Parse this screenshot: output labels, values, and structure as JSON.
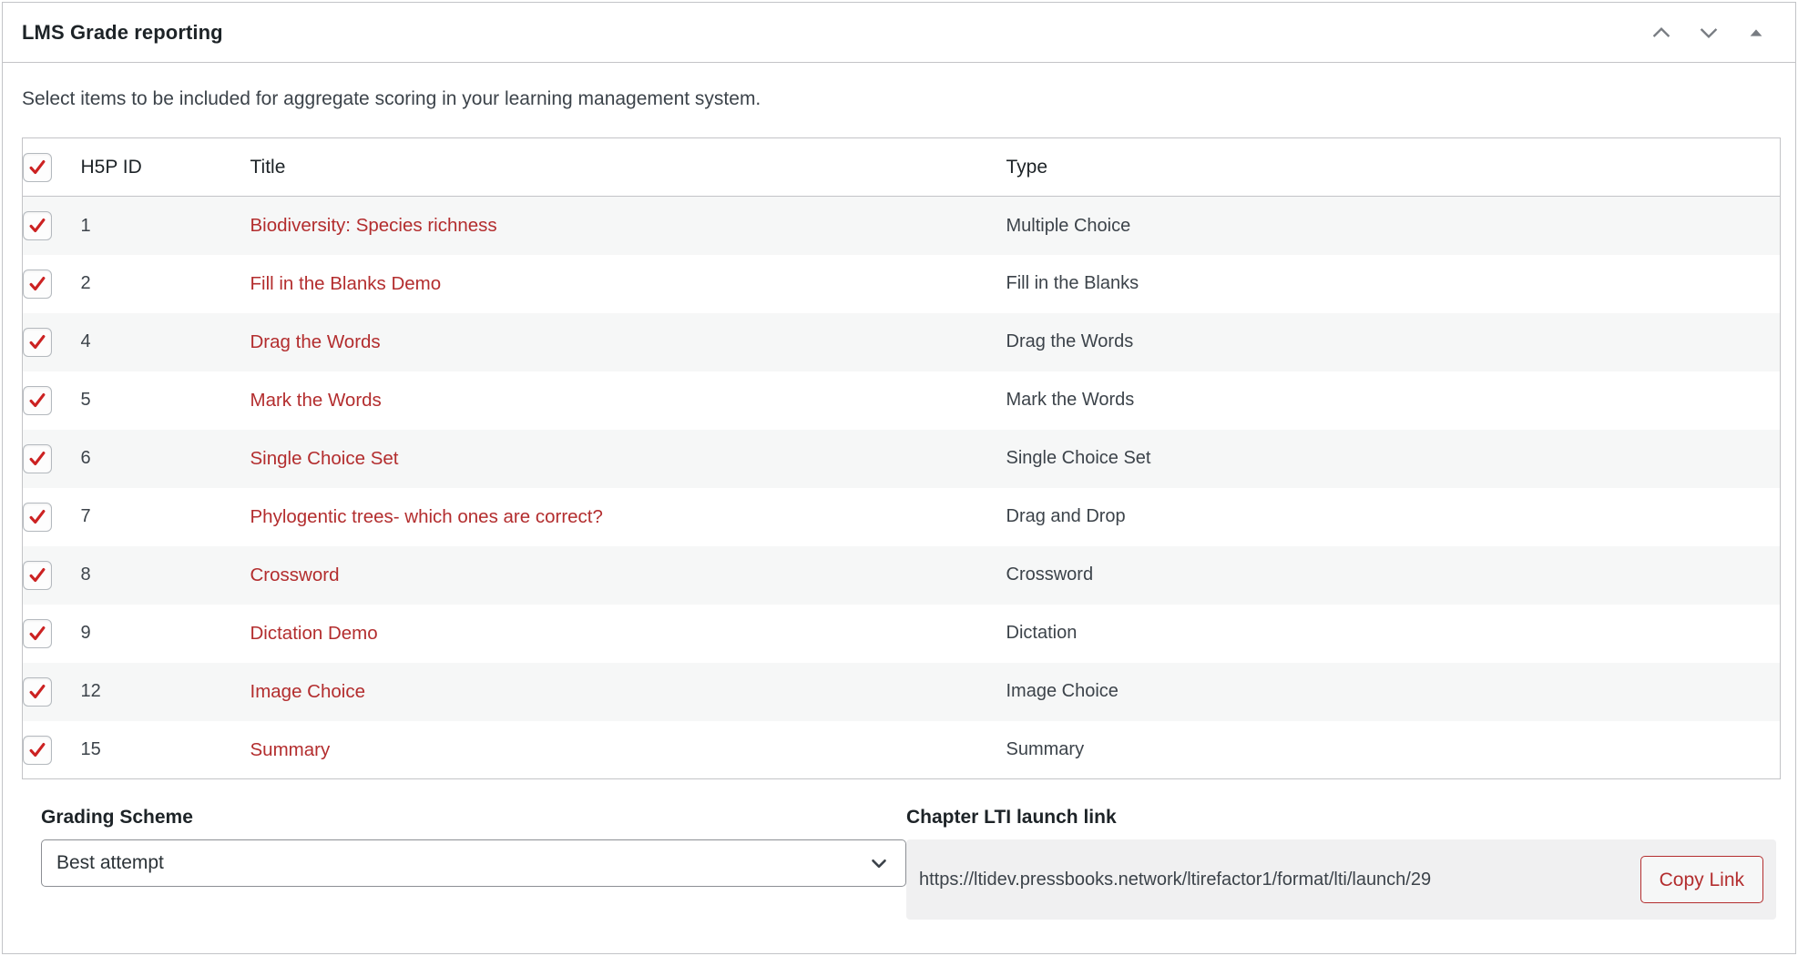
{
  "panel": {
    "title": "LMS Grade reporting",
    "intro": "Select items to be included for aggregate scoring in your learning management system.",
    "header_icons": [
      {
        "name": "chevron-up-icon",
        "label": "Move up"
      },
      {
        "name": "chevron-down-icon",
        "label": "Move down"
      },
      {
        "name": "collapse-triangle-icon",
        "label": "Toggle panel"
      }
    ]
  },
  "table": {
    "select_all_checked": true,
    "columns": {
      "checkbox": "",
      "id": "H5P ID",
      "title": "Title",
      "type": "Type"
    },
    "rows": [
      {
        "checked": true,
        "id": "1",
        "title": "Biodiversity: Species richness",
        "type": "Multiple Choice"
      },
      {
        "checked": true,
        "id": "2",
        "title": "Fill in the Blanks Demo",
        "type": "Fill in the Blanks"
      },
      {
        "checked": true,
        "id": "4",
        "title": "Drag the Words",
        "type": "Drag the Words"
      },
      {
        "checked": true,
        "id": "5",
        "title": "Mark the Words",
        "type": "Mark the Words"
      },
      {
        "checked": true,
        "id": "6",
        "title": "Single Choice Set",
        "type": "Single Choice Set"
      },
      {
        "checked": true,
        "id": "7",
        "title": "Phylogentic trees- which ones are correct?",
        "type": "Drag and Drop"
      },
      {
        "checked": true,
        "id": "8",
        "title": "Crossword",
        "type": "Crossword"
      },
      {
        "checked": true,
        "id": "9",
        "title": "Dictation Demo",
        "type": "Dictation"
      },
      {
        "checked": true,
        "id": "12",
        "title": "Image Choice",
        "type": "Image Choice"
      },
      {
        "checked": true,
        "id": "15",
        "title": "Summary",
        "type": "Summary"
      }
    ]
  },
  "grading": {
    "label": "Grading Scheme",
    "selected": "Best attempt"
  },
  "lti": {
    "label": "Chapter LTI launch link",
    "url": "https://ltidev.pressbooks.network/ltirefactor1/format/lti/launch/29",
    "copy_label": "Copy Link"
  },
  "colors": {
    "accent_red": "#b32d2e",
    "text": "#3c434a",
    "heading": "#1d2327",
    "border": "#c3c4c7",
    "stripe": "#f6f7f7",
    "lti_bg": "#f0f0f1"
  }
}
